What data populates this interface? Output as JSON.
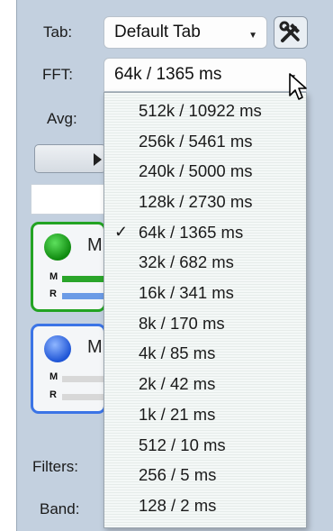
{
  "tab": {
    "label": "Tab:",
    "value": "Default Tab"
  },
  "fft": {
    "label": "FFT:",
    "value": "64k / 1365 ms"
  },
  "avg": {
    "label": "Avg:"
  },
  "channels": [
    {
      "name": "M",
      "meter_m": "M",
      "meter_r": "R",
      "accent": "#23a323"
    },
    {
      "name": "M",
      "meter_m": "M",
      "meter_r": "R",
      "accent": "#3b74e6"
    }
  ],
  "filters_label": "Filters:",
  "band_label": "Band:",
  "dropdown": {
    "selected": "64k / 1365 ms",
    "options": [
      "512k / 10922 ms",
      "256k / 5461 ms",
      "240k / 5000 ms",
      "128k / 2730 ms",
      "64k / 1365 ms",
      "32k / 682 ms",
      "16k / 341 ms",
      "8k / 170 ms",
      "4k / 85 ms",
      "2k / 42 ms",
      "1k / 21 ms",
      "512 / 10 ms",
      "256 / 5 ms",
      "128 / 2 ms"
    ]
  },
  "icons": {
    "tool": "hammer-wrench-icon",
    "check": "checkmark-icon",
    "cursor": "mouse-pointer-icon"
  }
}
